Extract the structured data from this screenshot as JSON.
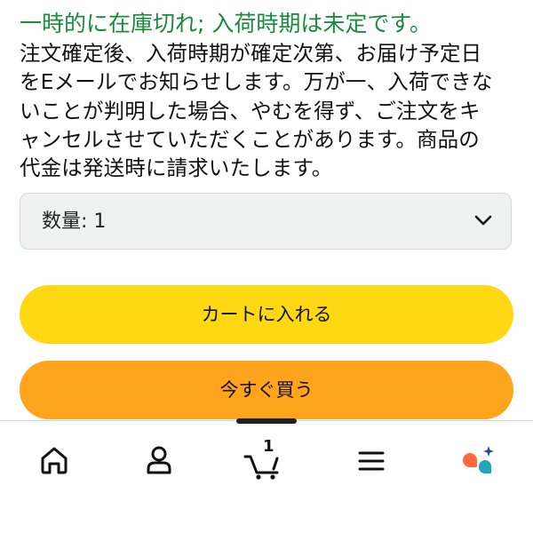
{
  "availability": "一時的に在庫切れ; 入荷時期は未定です。",
  "description_lines": [
    "注文確定後、入荷時期が確定次第、お届け予定日",
    "をEメールでお知らせします。万が一、入荷できな",
    "いことが判明した場合、やむを得ず、ご注文をキ",
    "ャンセルさせていただくことがあります。商品の",
    "代金は発送時に請求いたします。"
  ],
  "quantity": {
    "label": "数量:",
    "value": "1"
  },
  "buttons": {
    "add_to_cart": "カートに入れる",
    "buy_now": "今すぐ買う"
  },
  "bottom_nav": {
    "cart_count": "1",
    "items": [
      "home-icon",
      "account-icon",
      "cart-icon",
      "menu-icon",
      "rufus-icon"
    ]
  },
  "colors": {
    "availability_green": "#1a8a3c",
    "add_to_cart_yellow": "#ffd814",
    "buy_now_orange": "#ffa41c",
    "rufus_orange": "#ff6a3d",
    "rufus_teal": "#1fa7b8"
  }
}
